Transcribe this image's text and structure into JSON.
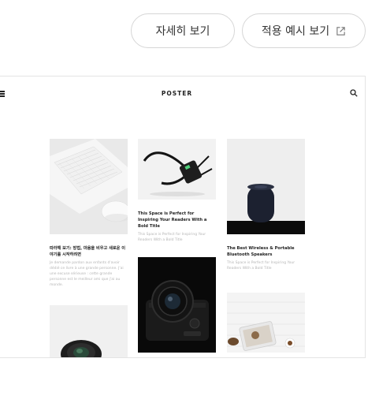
{
  "buttons": {
    "detail_label": "자세히 보기",
    "preview_label": "적용 예시 보기"
  },
  "preview": {
    "brand": "POSTER",
    "posts": [
      {
        "title": "따라해 보기: 방법, 마음을 비우고 새로운 이야기를 시작하려면",
        "excerpt": "Je demande pardon aux enfants d'avoir dédié ce livre à une grande personne. J'ai une excuse sérieuse : cette grande personne est le meilleur ami que j'ai au monde."
      },
      {
        "title": "This Space is Perfect for Inspiring Your Readers With a Bold Title",
        "excerpt": "This Space is Perfect for Inspiring Your Readers With a Bold Title"
      },
      {
        "title": "The Best Wireless & Portable Bluetooth Speakers",
        "excerpt": "This Space is Perfect for Inspiring Your Readers With a Bold Title"
      }
    ]
  }
}
